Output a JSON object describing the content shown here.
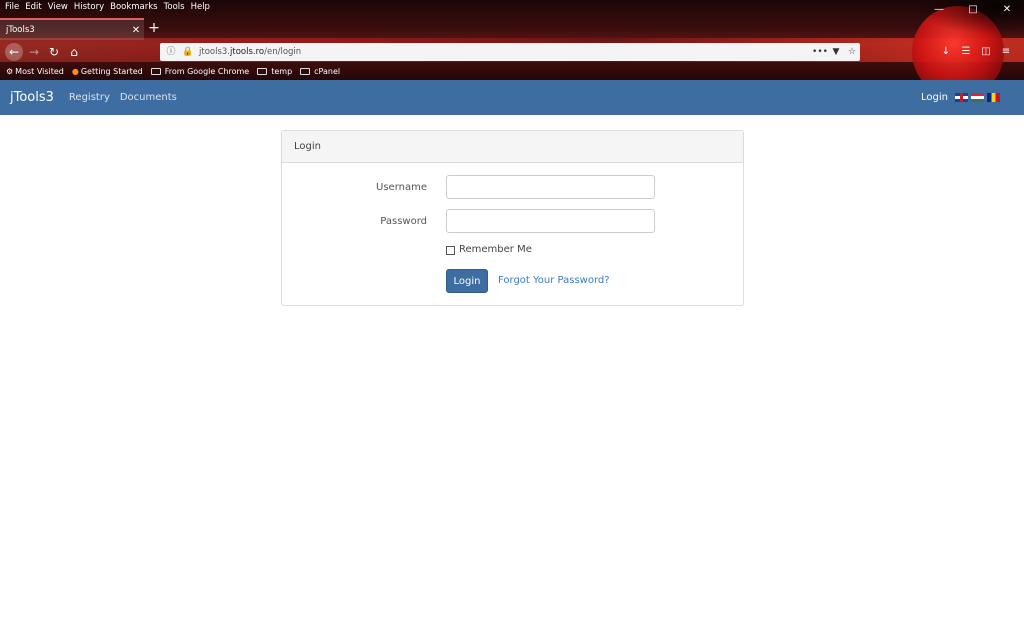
{
  "browser": {
    "menu": [
      "File",
      "Edit",
      "View",
      "History",
      "Bookmarks",
      "Tools",
      "Help"
    ],
    "tab_title": "jTools3",
    "url_prefix": "jtools3.",
    "url_domain": "jtools.ro",
    "url_path": "/en/login",
    "bookmarks": [
      "Most Visited",
      "Getting Started",
      "From Google Chrome",
      "temp",
      "cPanel"
    ],
    "theme_color": "#5e1616"
  },
  "site": {
    "brand": "jTools3",
    "nav_links": [
      "Registry",
      "Documents"
    ],
    "login_link": "Login",
    "nav_color": "#3e6ea1"
  },
  "login_panel": {
    "heading": "Login",
    "username_label": "Username",
    "username_value": "",
    "password_label": "Password",
    "password_value": "",
    "remember_label": "Remember Me",
    "remember_checked": false,
    "submit_label": "Login",
    "forgot_label": "Forgot Your Password?"
  }
}
